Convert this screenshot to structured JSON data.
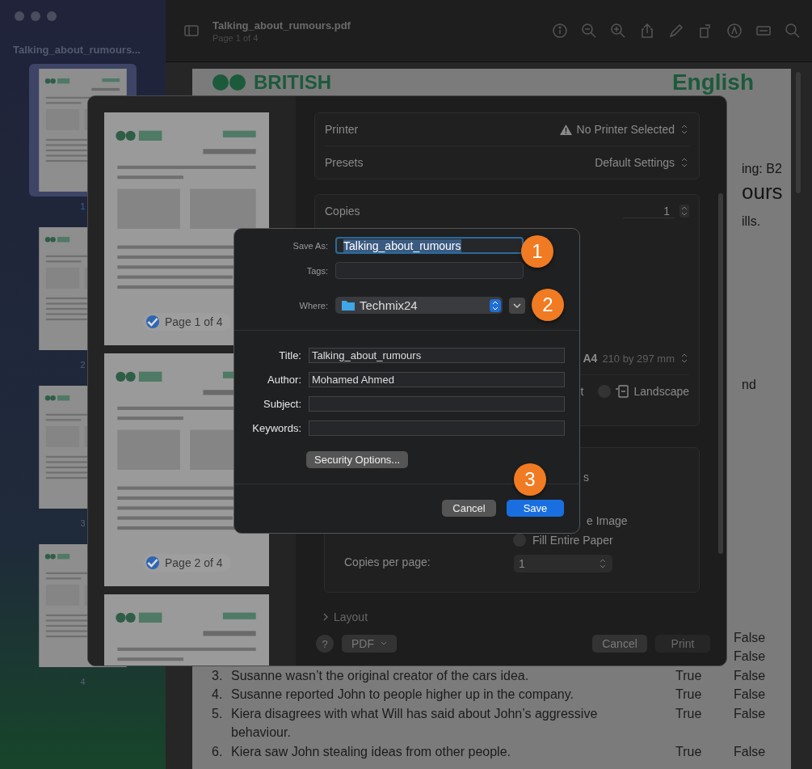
{
  "sidebar": {
    "title": "Talking_about_rumours...",
    "pages": [
      {
        "number": "1",
        "selected": true
      },
      {
        "number": "2",
        "selected": false
      },
      {
        "number": "3",
        "selected": false
      },
      {
        "number": "4",
        "selected": false
      }
    ]
  },
  "toolbar": {
    "title": "Talking_about_rumours.pdf",
    "subtitle": "Page 1 of 4"
  },
  "document": {
    "logo_text": "BRITISH",
    "brand_text": "English",
    "fragments": [
      "ing: B2",
      "ours",
      "ills.",
      "nd"
    ],
    "statements": [
      {
        "false_label": "False"
      },
      {
        "false_label": "False"
      },
      {
        "number": "3.",
        "text": "Susanne wasn’t the original creator of the cars idea.",
        "true_label": "True",
        "false_label": "False"
      },
      {
        "number": "4.",
        "text": "Susanne reported John to people higher up in the company.",
        "true_label": "True",
        "false_label": "False"
      },
      {
        "number": "5.",
        "text": "Kiera disagrees with what Will has said about John’s aggressive behaviour.",
        "true_label": "True",
        "false_label": "False"
      },
      {
        "number": "6.",
        "text": "Kiera saw John stealing ideas from other people.",
        "true_label": "True",
        "false_label": "False"
      }
    ]
  },
  "print_dialog": {
    "previews": [
      {
        "label": "Page 1 of 4",
        "checked": true
      },
      {
        "label": "Page 2 of 4",
        "checked": true
      }
    ],
    "printer": {
      "label": "Printer",
      "value": "No Printer Selected"
    },
    "presets": {
      "label": "Presets",
      "value": "Default Settings"
    },
    "copies": {
      "label": "Copies",
      "value": "1"
    },
    "paper_size": {
      "value": "A4",
      "detail": "210 by 297 mm"
    },
    "orientation": {
      "portrait_label": "t",
      "landscape_label": "Landscape",
      "landscape_selected": false
    },
    "scale_fragment": "s",
    "image_option": "e Image",
    "fill_option": {
      "label": "Fill Entire Paper",
      "selected": false
    },
    "copies_per_page": {
      "label": "Copies per page:",
      "value": "1"
    },
    "layout": {
      "label": "Layout"
    },
    "help": "?",
    "pdf": "PDF",
    "cancel": "Cancel",
    "print": {
      "label": "Print",
      "disabled": true
    }
  },
  "save_dialog": {
    "save_as": {
      "label": "Save As:",
      "value": "Talking_about_rumours"
    },
    "tags": {
      "label": "Tags:"
    },
    "where": {
      "label": "Where:",
      "value": "Techmix24"
    },
    "metadata": [
      {
        "label": "Title:",
        "value": "Talking_about_rumours"
      },
      {
        "label": "Author:",
        "value": "Mohamed Ahmed"
      },
      {
        "label": "Subject:"
      },
      {
        "label": "Keywords:"
      }
    ],
    "security_button": "Security Options...",
    "cancel": "Cancel",
    "save": "Save"
  },
  "annotations": [
    {
      "number": "1"
    },
    {
      "number": "2"
    },
    {
      "number": "3"
    }
  ]
}
